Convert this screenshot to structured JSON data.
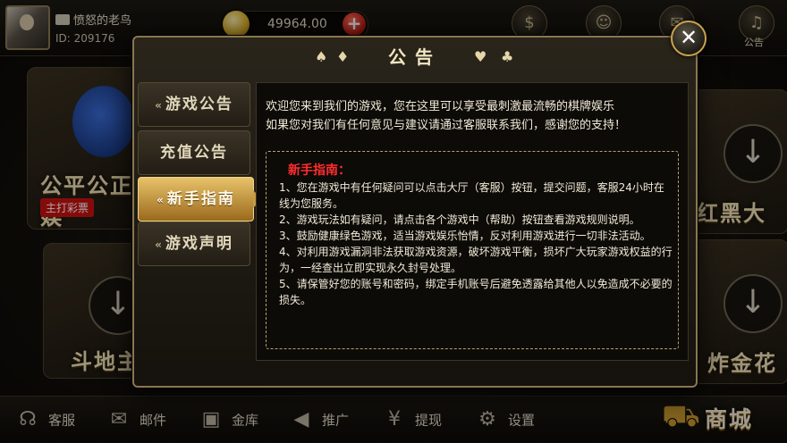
{
  "user": {
    "name": "愤怒的老鸟",
    "id": "ID: 209176",
    "gold": "49964.00",
    "add_label": "+"
  },
  "top_icons": [
    {
      "icon": "dollar-icon",
      "glyph": "$"
    },
    {
      "icon": "friends-icon",
      "glyph": "☺"
    },
    {
      "icon": "gift-icon",
      "glyph": "✉"
    },
    {
      "icon": "bell-icon",
      "glyph": "♫",
      "label": "公告"
    }
  ],
  "background_tiles": {
    "left_top": "公平公正 娱",
    "left_badge": "主打彩票",
    "left_bottom": "斗地主",
    "right_top": "红黑大",
    "right_bottom": "炸金花"
  },
  "dialog": {
    "title": "公告",
    "suits": [
      "♠",
      "♦",
      "♥",
      "♣"
    ],
    "close": "✕",
    "tabs": [
      {
        "label": "游戏公告",
        "active": false
      },
      {
        "label": "充值公告",
        "active": false
      },
      {
        "label": "新手指南",
        "active": true
      },
      {
        "label": "游戏声明",
        "active": false
      }
    ],
    "intro_lines": [
      "欢迎您来到我们的游戏，您在这里可以享受最刺激最流畅的棋牌娱乐",
      "如果您对我们有任何意见与建议请通过客服联系我们，感谢您的支持！"
    ],
    "guide_title": "新手指南：",
    "guide_items": [
      "1、您在游戏中有任何疑问可以点击大厅（客服）按钮，提交问题，客服24小时在线为您服务。",
      "2、游戏玩法如有疑问，请点击各个游戏中（帮助）按钮查看游戏规则说明。",
      "3、鼓励健康绿色游戏，适当游戏娱乐怡情，反对利用游戏进行一切非法活动。",
      "4、对利用游戏漏洞非法获取游戏资源，破坏游戏平衡，损坏广大玩家游戏权益的行为，一经查出立即实现永久封号处理。",
      "5、请保管好您的账号和密码，绑定手机账号后避免透露给其他人以免造成不必要的损失。"
    ]
  },
  "bottom_nav": [
    {
      "label": "客服",
      "icon": "headset-icon",
      "glyph": "☊"
    },
    {
      "label": "邮件",
      "icon": "mail-icon",
      "glyph": "✉"
    },
    {
      "label": "金库",
      "icon": "safe-icon",
      "glyph": "▣"
    },
    {
      "label": "推广",
      "icon": "megaphone-icon",
      "glyph": "◀"
    },
    {
      "label": "提现",
      "icon": "withdraw-icon",
      "glyph": "¥"
    },
    {
      "label": "设置",
      "icon": "gear-icon",
      "glyph": "⚙"
    }
  ],
  "shop_label": "商城"
}
